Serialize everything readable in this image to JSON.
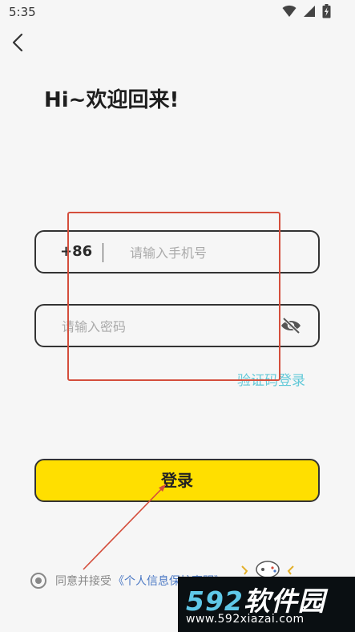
{
  "status_bar": {
    "time": "5:35",
    "icons": [
      "wifi-icon",
      "signal-icon",
      "battery-charging-icon"
    ]
  },
  "title": "Hi~欢迎回来!",
  "phone_field": {
    "country_code": "+86",
    "placeholder": "请输入手机号",
    "value": ""
  },
  "password_field": {
    "placeholder": "请输入密码",
    "value": "",
    "toggle_icon": "eye-off-icon"
  },
  "sms_login_link": "验证码登录",
  "login_button": "登录",
  "agreement": {
    "prefix": "同意并接受",
    "link": "《个人信息保护声明》",
    "checked": true
  },
  "watermark": {
    "number": "592",
    "text": "软件园",
    "url": "www.592xiazai.com"
  },
  "colors": {
    "accent_yellow": "#ffdf00",
    "link_teal": "#63c9d8",
    "link_blue": "#4b78c4",
    "annotation_red": "#d44e3c",
    "background": "#f6f6f6"
  }
}
